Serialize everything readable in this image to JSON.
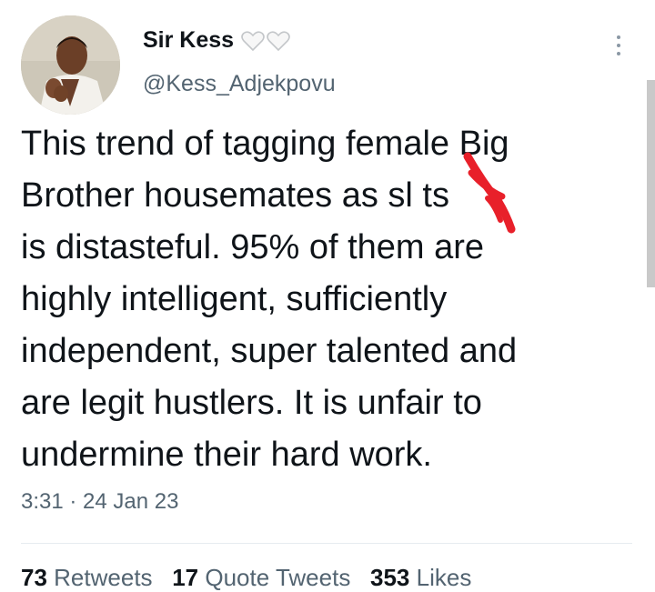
{
  "author": {
    "display_name": "Sir Kess",
    "handle": "@Kess_Adjekpovu",
    "badges": [
      "white-heart-icon",
      "white-heart-icon"
    ]
  },
  "tweet": {
    "lines": [
      "This trend of tagging female Big",
      "Brother housemates as sl  ts",
      "is distasteful. 95% of them are",
      "highly intelligent, sufficiently",
      "independent, super talented and",
      "are legit hustlers. It is unfair to",
      "undermine their hard work."
    ],
    "timestamp": "3:31 · 24 Jan 23"
  },
  "stats": {
    "retweets_count": "73",
    "retweets_label": "Retweets",
    "quotes_count": "17",
    "quotes_label": "Quote Tweets",
    "likes_count": "353",
    "likes_label": "Likes"
  },
  "colors": {
    "text": "#0f1419",
    "secondary": "#536471",
    "redaction": "#e8202a"
  }
}
